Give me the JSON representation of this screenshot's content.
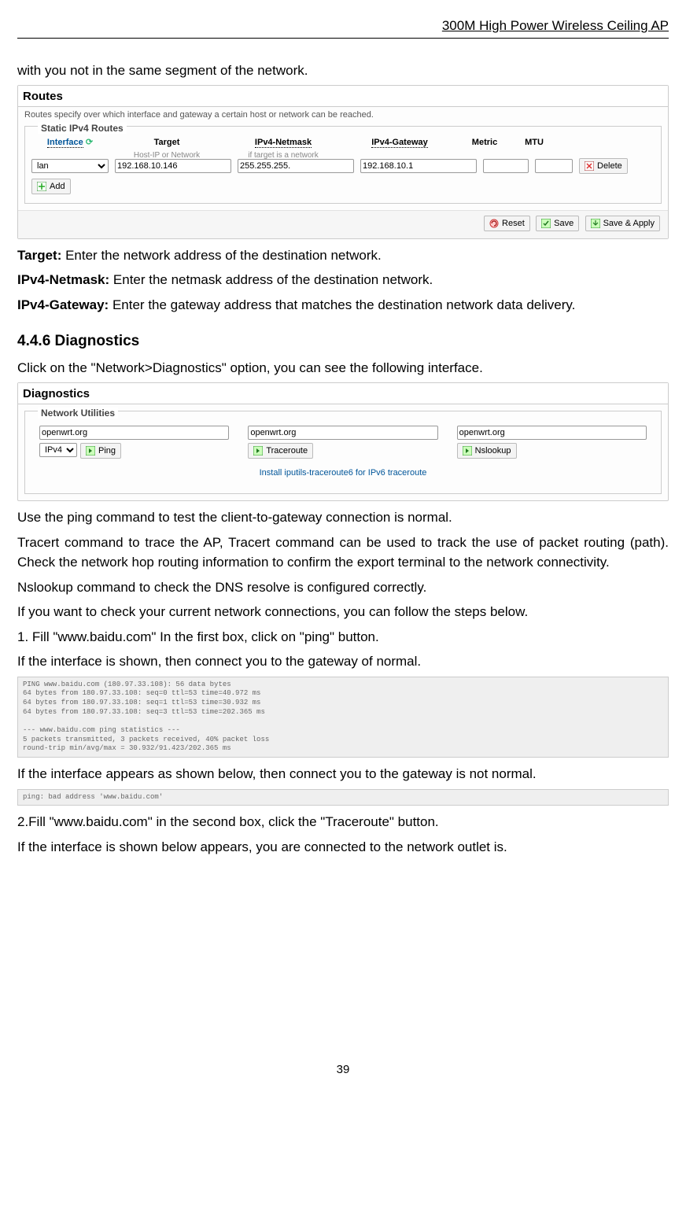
{
  "header": "300M High Power Wireless Ceiling AP",
  "intro": "with you not in the same segment of the network.",
  "routes": {
    "title": "Routes",
    "desc": "Routes specify over which interface and gateway a certain host or network can be reached.",
    "fieldset": "Static IPv4 Routes",
    "headers": [
      "Interface",
      "Target",
      "IPv4-Netmask",
      "IPv4-Gateway",
      "Metric",
      "MTU"
    ],
    "subheaders": [
      "",
      "Host-IP or Network",
      "if target is a network",
      "",
      "",
      ""
    ],
    "row": {
      "interface": "lan",
      "target": "192.168.10.146",
      "netmask": "255.255.255.",
      "gateway": "192.168.10.1",
      "metric": "",
      "mtu": ""
    },
    "delete": "Delete",
    "add": "Add",
    "reset": "Reset",
    "save": "Save",
    "saveapply": "Save & Apply"
  },
  "paragraphs1": [
    {
      "bold": "Target:",
      "text": " Enter the network address of the destination network."
    },
    {
      "bold": "IPv4-Netmask:",
      "text": " Enter the netmask address of the destination network."
    },
    {
      "bold": "IPv4-Gateway:",
      "text": " Enter the gateway address that matches the destination network data delivery."
    }
  ],
  "section": "4.4.6 Diagnostics",
  "diag_intro": "Click on the \"Network>Diagnostics\" option, you can see the following interface.",
  "diag": {
    "title": "Diagnostics",
    "fieldset": "Network Utilities",
    "col1_val": "openwrt.org",
    "col2_val": "openwrt.org",
    "col3_val": "openwrt.org",
    "ipv4": "IPv4",
    "ping": "Ping",
    "traceroute": "Traceroute",
    "nslookup": "Nslookup",
    "install": "Install iputils-traceroute6 for IPv6 traceroute"
  },
  "paragraphs2": [
    "Use the ping command to test the client-to-gateway connection is normal.",
    "Tracert command to trace the AP, Tracert command can be used to track the use of packet routing (path). Check the network hop routing information to confirm the export terminal to the network connectivity.",
    "Nslookup command to check the DNS resolve is configured correctly.",
    "If you want to check your current network connections, you can follow the steps below.",
    "1.  Fill \"www.baidu.com\" In the first box, click on \"ping\" button.",
    "If the interface is shown, then connect you to the gateway of normal."
  ],
  "console1": "PING www.baidu.com (180.97.33.108): 56 data bytes\n64 bytes from 180.97.33.108: seq=0 ttl=53 time=40.972 ms\n64 bytes from 180.97.33.108: seq=1 ttl=53 time=30.932 ms\n64 bytes from 180.97.33.108: seq=3 ttl=53 time=202.365 ms\n\n--- www.baidu.com ping statistics ---\n5 packets transmitted, 3 packets received, 40% packet loss\nround-trip min/avg/max = 30.932/91.423/202.365 ms",
  "para_mid": "If the interface appears as shown below, then connect you to the gateway is not normal.",
  "console2": "ping: bad address 'www.baidu.com'",
  "para3": "2.Fill \"www.baidu.com\" in the second box, click the \"Traceroute\" button.",
  "para4": "If the interface is shown below appears, you are connected to the network outlet is.",
  "pagenum": "39"
}
